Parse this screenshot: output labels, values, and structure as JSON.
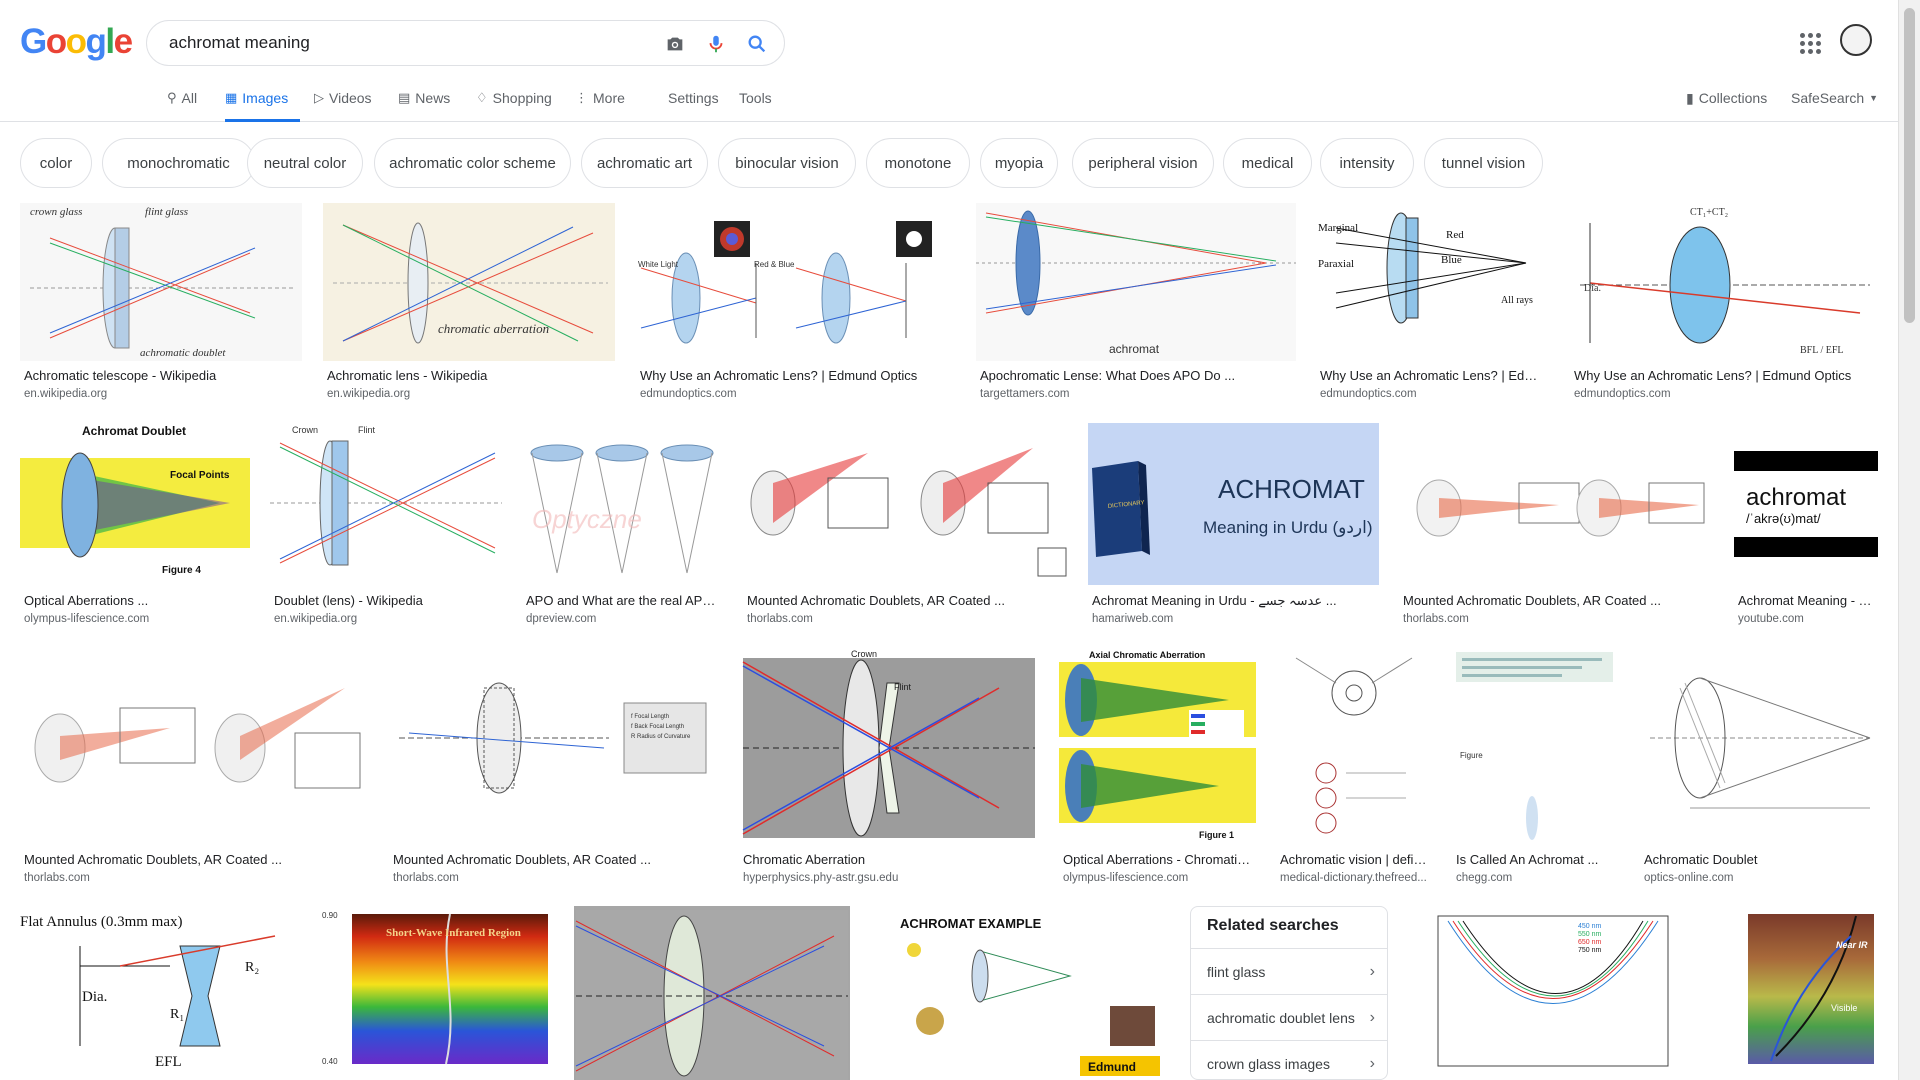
{
  "logo": {
    "letters": [
      "G",
      "o",
      "o",
      "g",
      "l",
      "e"
    ],
    "colors": [
      "#4285F4",
      "#EA4335",
      "#FBBC05",
      "#4285F4",
      "#34A853",
      "#EA4335"
    ]
  },
  "search": {
    "query": "achromat meaning",
    "icons": [
      "camera-icon",
      "microphone-icon",
      "search-icon"
    ]
  },
  "nav": {
    "tabs": [
      {
        "label": "All",
        "icon": "search-icon"
      },
      {
        "label": "Images",
        "icon": "image-icon",
        "active": true
      },
      {
        "label": "Videos",
        "icon": "video-icon"
      },
      {
        "label": "News",
        "icon": "news-icon"
      },
      {
        "label": "Shopping",
        "icon": "tag-icon"
      },
      {
        "label": "More",
        "icon": "more-vert-icon"
      }
    ],
    "settings": "Settings",
    "tools": "Tools",
    "collections": "Collections",
    "safesearch": "SafeSearch"
  },
  "chips": [
    "color",
    "monochromatic",
    "neutral color",
    "achromatic color scheme",
    "achromatic art",
    "binocular vision",
    "monotone",
    "myopia",
    "peripheral vision",
    "medical",
    "intensity",
    "tunnel vision"
  ],
  "results": [
    {
      "title": "Achromatic telescope - Wikipedia",
      "source": "en.wikipedia.org",
      "caption": "achromatic doublet"
    },
    {
      "title": "Achromatic lens - Wikipedia",
      "source": "en.wikipedia.org",
      "caption": "chromatic aberration"
    },
    {
      "title": "Why Use an Achromatic Lens? | Edmund Optics",
      "source": "edmundoptics.com",
      "caption": ""
    },
    {
      "title": "Apochromatic Lense: What Does APO Do ...",
      "source": "targettamers.com",
      "caption": "achromat"
    },
    {
      "title": "Why Use an Achromatic Lens? | Edmu...",
      "source": "edmundoptics.com",
      "caption": ""
    },
    {
      "title": "Why Use an Achromatic Lens? | Edmund Optics",
      "source": "edmundoptics.com",
      "caption": ""
    },
    {
      "title": "Optical Aberrations ...",
      "source": "olympus-lifescience.com",
      "caption": "Achromat Doublet"
    },
    {
      "title": "Doublet (lens) - Wikipedia",
      "source": "en.wikipedia.org",
      "caption": ""
    },
    {
      "title": "APO and What are the real APO...",
      "source": "dpreview.com",
      "caption": ""
    },
    {
      "title": "Mounted Achromatic Doublets, AR Coated ...",
      "source": "thorlabs.com",
      "caption": ""
    },
    {
      "title": "Achromat Meaning in Urdu - عدسہ جسے ...",
      "source": "hamariweb.com",
      "caption": "ACHROMAT",
      "caption2": "Meaning in Urdu (اردو)"
    },
    {
      "title": "Mounted Achromatic Doublets, AR Coated ...",
      "source": "thorlabs.com",
      "caption": ""
    },
    {
      "title": "Achromat Meaning - Y...",
      "source": "youtube.com",
      "caption": "achromat",
      "caption2": "/ˈakrə(ʊ)mat/"
    },
    {
      "title": "Mounted Achromatic Doublets, AR Coated ...",
      "source": "thorlabs.com",
      "caption": ""
    },
    {
      "title": "Mounted Achromatic Doublets, AR Coated ...",
      "source": "thorlabs.com",
      "caption": ""
    },
    {
      "title": "Chromatic Aberration",
      "source": "hyperphysics.phy-astr.gsu.edu",
      "caption": ""
    },
    {
      "title": "Optical Aberrations - Chromatic ...",
      "source": "olympus-lifescience.com",
      "caption": "Axial Chromatic Aberration"
    },
    {
      "title": "Achromatic vision | defin...",
      "source": "medical-dictionary.thefreed...",
      "caption": ""
    },
    {
      "title": "Is Called An Achromat ...",
      "source": "chegg.com",
      "caption": ""
    },
    {
      "title": "Achromatic Doublet",
      "source": "optics-online.com",
      "caption": ""
    },
    {
      "title": "",
      "source": "",
      "caption": "Flat Annulus (0.3mm max)"
    },
    {
      "title": "",
      "source": "",
      "caption": "Short-Wave Infrared Region"
    },
    {
      "title": "",
      "source": "",
      "caption": ""
    },
    {
      "title": "",
      "source": "",
      "caption": "ACHROMAT EXAMPLE"
    },
    {
      "title": "",
      "source": "",
      "caption": ""
    },
    {
      "title": "",
      "source": "",
      "caption": "Near IR"
    }
  ],
  "related": {
    "title": "Related searches",
    "items": [
      "flint glass",
      "achromatic doublet lens",
      "crown glass images"
    ]
  }
}
